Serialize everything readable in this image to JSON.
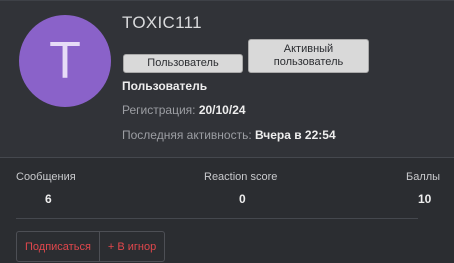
{
  "profile": {
    "avatar_letter": "T",
    "avatar_color": "#8a62c9",
    "username": "TOXIC111",
    "badges": [
      "Пользователь",
      "Активный пользователь"
    ],
    "role_title": "Пользователь",
    "registration_label": "Регистрация:",
    "registration_value": "20/10/24",
    "last_activity_label": "Последняя активность:",
    "last_activity_value": "Вчера в 22:54"
  },
  "stats": {
    "messages_label": "Сообщения",
    "messages_value": "6",
    "reaction_label": "Reaction score",
    "reaction_value": "0",
    "points_label": "Баллы",
    "points_value": "10"
  },
  "actions": {
    "follow_label": "Подписаться",
    "ignore_label": "+ В игнор",
    "accent_color": "#e0474c"
  }
}
